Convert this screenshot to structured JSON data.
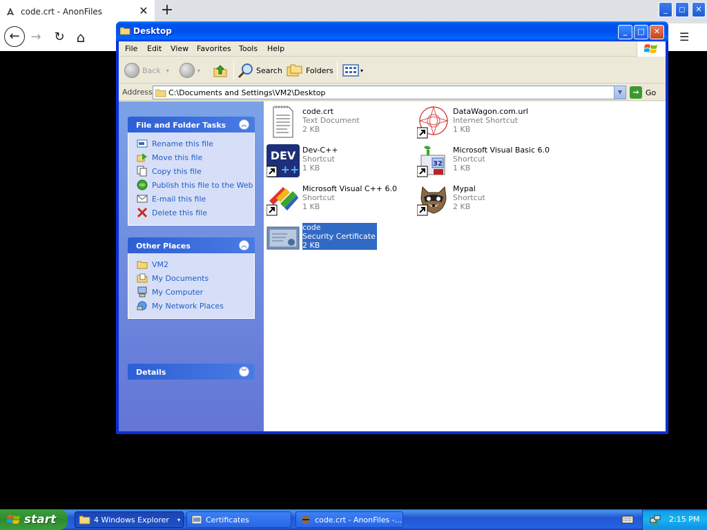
{
  "browser": {
    "tab_title": "code.crt - AnonFiles",
    "tab_close": "✕",
    "new_tab": "+",
    "back": "←",
    "forward": "→",
    "reload": "↻",
    "home": "⌂"
  },
  "window": {
    "title": "Desktop",
    "minimize": "_",
    "maximize": "□",
    "close": "✕"
  },
  "menu": [
    "File",
    "Edit",
    "View",
    "Favorites",
    "Tools",
    "Help"
  ],
  "toolbar": {
    "back": "Back",
    "search": "Search",
    "folders": "Folders"
  },
  "address": {
    "label": "Address",
    "value": "C:\\Documents and Settings\\VM2\\Desktop",
    "go": "Go"
  },
  "tasks_panel": {
    "title": "File and Folder Tasks",
    "items": [
      {
        "label": "Rename this file",
        "icon": "rename-icon"
      },
      {
        "label": "Move this file",
        "icon": "move-icon"
      },
      {
        "label": "Copy this file",
        "icon": "copy-icon"
      },
      {
        "label": "Publish this file to the Web",
        "icon": "publish-web-icon"
      },
      {
        "label": "E-mail this file",
        "icon": "email-icon"
      },
      {
        "label": "Delete this file",
        "icon": "delete-icon"
      }
    ]
  },
  "places_panel": {
    "title": "Other Places",
    "items": [
      {
        "label": "VM2",
        "icon": "folder-icon"
      },
      {
        "label": "My Documents",
        "icon": "my-documents-icon"
      },
      {
        "label": "My Computer",
        "icon": "my-computer-icon"
      },
      {
        "label": "My Network Places",
        "icon": "network-icon"
      }
    ]
  },
  "details_panel": {
    "title": "Details"
  },
  "files": [
    {
      "name": "code.crt",
      "type": "Text Document",
      "size": "2 KB",
      "icon": "text-document-icon"
    },
    {
      "name": "DataWagon.com.url",
      "type": "Internet Shortcut",
      "size": "1 KB",
      "icon": "internet-shortcut-icon"
    },
    {
      "name": "Dev-C++",
      "type": "Shortcut",
      "size": "1 KB",
      "icon": "devcpp-icon"
    },
    {
      "name": "Microsoft Visual Basic 6.0",
      "type": "Shortcut",
      "size": "1 KB",
      "icon": "visual-basic-icon"
    },
    {
      "name": "Microsoft Visual C++ 6.0",
      "type": "Shortcut",
      "size": "1 KB",
      "icon": "visual-cpp-icon"
    },
    {
      "name": "Mypal",
      "type": "Shortcut",
      "size": "2 KB",
      "icon": "mypal-icon"
    },
    {
      "name": "code",
      "type": "Security Certificate",
      "size": "2 KB",
      "icon": "certificate-icon"
    }
  ],
  "taskbar": {
    "start": "start",
    "buttons": [
      {
        "label": "4 Windows Explorer",
        "icon": "folder-icon"
      },
      {
        "label": "Certificates",
        "icon": "certificates-icon"
      },
      {
        "label": "code.crt - AnonFiles -...",
        "icon": "mypal-icon"
      }
    ],
    "clock": "2:15 PM"
  }
}
